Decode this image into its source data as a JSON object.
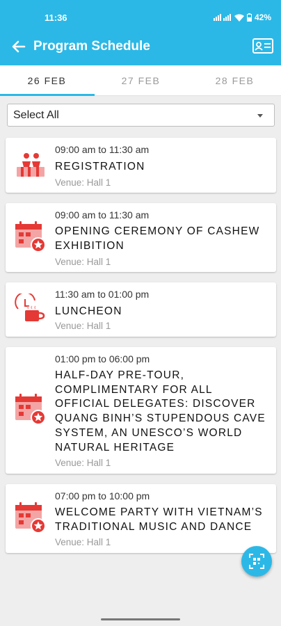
{
  "status_bar": {
    "time": "11:36",
    "battery": "42%"
  },
  "header": {
    "title": "Program Schedule",
    "back_icon": "arrow-left-icon",
    "card_icon": "id-card-icon"
  },
  "tabs": [
    {
      "label": "26 FEB",
      "active": true
    },
    {
      "label": "27 FEB",
      "active": false
    },
    {
      "label": "28 FEB",
      "active": false
    }
  ],
  "filter": {
    "selected": "Select All"
  },
  "events": [
    {
      "time": "09:00 am to 11:30 am",
      "title": "REGISTRATION",
      "venue": "Venue: Hall 1",
      "icon": "registration-icon"
    },
    {
      "time": "09:00 am to 11:30 am",
      "title": "OPENING CEREMONY OF CASHEW EXHIBITION",
      "venue": "Venue: Hall 1",
      "icon": "calendar-star-icon"
    },
    {
      "time": "11:30 am to 01:00 pm",
      "title": "LUNCHEON",
      "venue": "Venue: Hall 1",
      "icon": "coffee-clock-icon"
    },
    {
      "time": "01:00 pm to 06:00 pm",
      "title": "HALF-DAY PRE-TOUR, COMPLIMENTARY FOR ALL OFFICIAL DELEGATES: DISCOVER QUANG BINH’S STUPENDOUS CAVE SYSTEM, AN UNESCO’S WORLD NATURAL HERITAGE",
      "venue": "Venue: Hall 1",
      "icon": "calendar-star-icon"
    },
    {
      "time": "07:00 pm to 10:00 pm",
      "title": "WELCOME PARTY WITH VIETNAM’S TRADITIONAL MUSIC AND DANCE",
      "venue": "Venue: Hall 1",
      "icon": "calendar-star-icon"
    }
  ],
  "fab": {
    "icon": "qr-scan-icon"
  },
  "colors": {
    "primary": "#2cb8e6",
    "accent": "#e53935",
    "accent_light": "#f3a5a5"
  }
}
